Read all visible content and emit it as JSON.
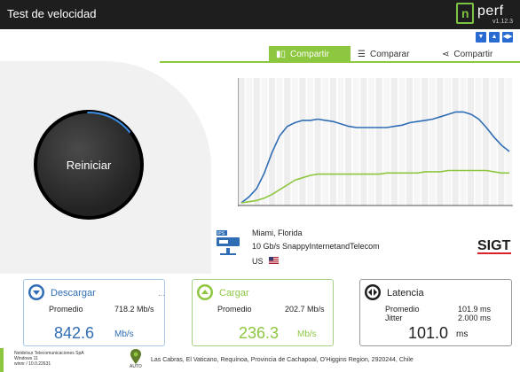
{
  "app": {
    "title": "Test de velocidad",
    "logo_word": "perf",
    "logo_mark": "n",
    "version": "v1.12.3"
  },
  "tabs": [
    {
      "label": "Compartir",
      "icon": "chart-icon",
      "active": true
    },
    {
      "label": "Comparar",
      "icon": "compare-icon",
      "active": false
    },
    {
      "label": "Compartir",
      "icon": "share-icon",
      "active": false
    }
  ],
  "gauge": {
    "label": "Reiniciar",
    "progress": 0.14
  },
  "chart_data": {
    "type": "area",
    "series": [
      {
        "values": [
          0.0,
          0.05,
          0.12,
          0.25,
          0.42,
          0.56,
          0.64,
          0.67,
          0.69,
          0.69,
          0.7,
          0.69,
          0.68,
          0.66,
          0.64,
          0.63,
          0.63,
          0.63,
          0.63,
          0.63,
          0.64,
          0.65,
          0.67,
          0.68,
          0.69,
          0.7,
          0.72,
          0.74,
          0.76,
          0.76,
          0.74,
          0.7,
          0.63,
          0.55,
          0.48,
          0.43
        ],
        "color": "#2f6db5"
      },
      {
        "values": [
          0.0,
          0.01,
          0.02,
          0.04,
          0.07,
          0.11,
          0.15,
          0.19,
          0.21,
          0.23,
          0.24,
          0.24,
          0.24,
          0.24,
          0.24,
          0.24,
          0.24,
          0.24,
          0.24,
          0.25,
          0.25,
          0.25,
          0.25,
          0.25,
          0.26,
          0.26,
          0.26,
          0.27,
          0.27,
          0.27,
          0.27,
          0.27,
          0.27,
          0.26,
          0.25,
          0.25
        ],
        "color": "#8dc63f"
      }
    ],
    "grid": true
  },
  "server": {
    "city": "Miami, Florida",
    "isp": "10 Gb/s SnappyInternetandTelecom",
    "country": "US",
    "brand": "SIGT"
  },
  "download": {
    "title": "Descargar",
    "avg_label": "Promedio",
    "avg_value": "718.2 Mb/s",
    "value": "842.6",
    "unit": "Mb/s",
    "color": "#2f6db5"
  },
  "upload": {
    "title": "Cargar",
    "avg_label": "Promedio",
    "avg_value": "202.7 Mb/s",
    "value": "236.3",
    "unit": "Mb/s",
    "color": "#8dc63f"
  },
  "latency": {
    "title": "Latencia",
    "avg_label": "Promedio",
    "avg_value": "101.9 ms",
    "jitter_label": "Jitter",
    "jitter_value": "2.000 ms",
    "value": "101.0",
    "unit": "ms"
  },
  "footer": {
    "org": "Netdelsur Telecomunicaciones SpA",
    "os": "Windows 11",
    "network": "winnr / 10.0.22631",
    "auto": "AUTO",
    "address": "Las Cabras, El Vaticano, Requínoa, Provincia de Cachapoal, O'Higgins Region, 2920244, Chile"
  }
}
